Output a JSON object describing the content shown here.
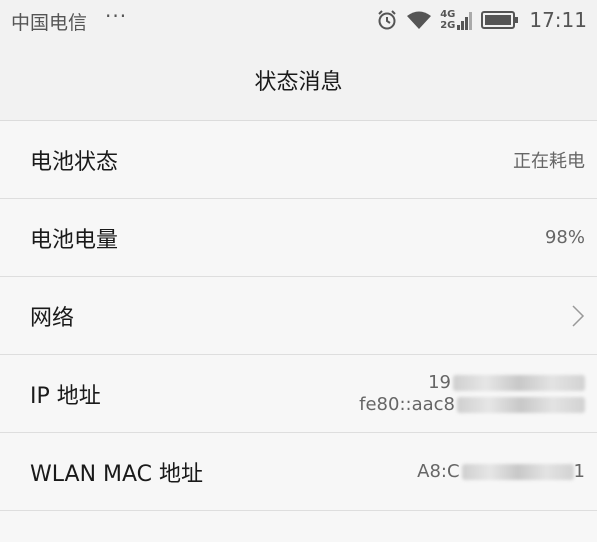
{
  "status_bar": {
    "carrier": "中国电信",
    "more": "···",
    "network_top": "4G",
    "network_bottom": "2G",
    "time": "17:11"
  },
  "header": {
    "title": "状态消息"
  },
  "rows": [
    {
      "label": "电池状态",
      "value": "正在耗电"
    },
    {
      "label": "电池电量",
      "value": "98%"
    },
    {
      "label": "网络"
    },
    {
      "label": "IP 地址",
      "value_line1": "19",
      "value_line2": "fe80::aac8"
    },
    {
      "label": "WLAN MAC 地址",
      "value": "A8:C",
      "value_tail": "1"
    }
  ]
}
